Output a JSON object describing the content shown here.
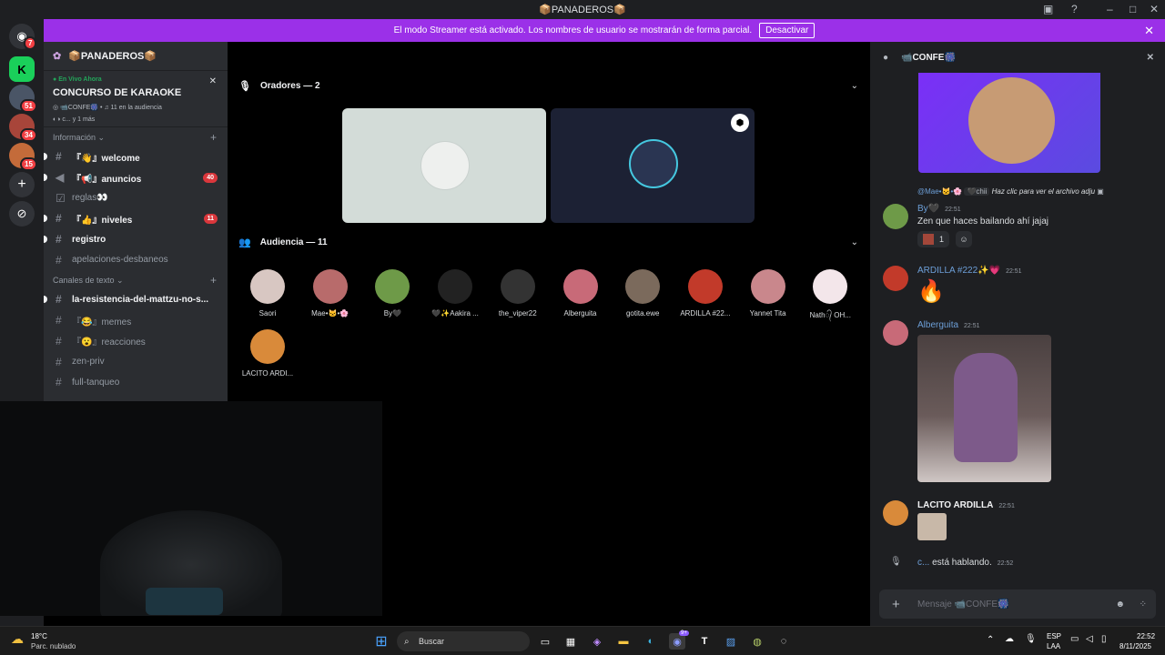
{
  "window": {
    "title": "📦PANADEROS📦"
  },
  "banner": {
    "text": "El modo Streamer está activado. Los nombres de usuario se mostrarán de forma parcial.",
    "button": "Desactivar"
  },
  "guilds": {
    "home_badge": "7",
    "items": [
      {
        "name": "server-k",
        "badge": ""
      },
      {
        "name": "server-2",
        "badge": "51"
      },
      {
        "name": "server-3",
        "badge": "34"
      },
      {
        "name": "server-4",
        "badge": "15"
      }
    ]
  },
  "server": {
    "name": "📦PANADEROS📦"
  },
  "live": {
    "status": "En Vivo Ahora",
    "title": "CONCURSO DE KARAOKE",
    "channel": "📹CONFE🎆",
    "audience": "11 en la audiencia",
    "participants": "c... y 1 más"
  },
  "categories": {
    "info": "Información",
    "text": "Canales de texto"
  },
  "channels_info": [
    {
      "label": "『👋』welcome",
      "unread": true,
      "count": ""
    },
    {
      "label": "『📢』anuncios",
      "unread": true,
      "count": "40"
    },
    {
      "label": "reglas👀",
      "unread": false,
      "count": ""
    },
    {
      "label": "『👍』niveles",
      "unread": true,
      "count": "11"
    },
    {
      "label": "registro",
      "unread": true,
      "count": ""
    },
    {
      "label": "apelaciones-desbaneos",
      "unread": false,
      "count": ""
    }
  ],
  "channels_text": [
    {
      "label": "la-resistencia-del-mattzu-no-s...",
      "unread": true
    },
    {
      "label": "『😂』memes",
      "unread": false
    },
    {
      "label": "『😮』reacciones",
      "unread": false
    },
    {
      "label": "zen-priv",
      "unread": false
    },
    {
      "label": "full-tanqueo",
      "unread": false
    }
  ],
  "stage": {
    "speakers_label": "Oradores — 2",
    "audience_label": "Audiencia — 11",
    "audience": [
      {
        "name": "Saori",
        "color": "#d8c7c2"
      },
      {
        "name": "Mae•🐱•🌸",
        "color": "#b86b6b"
      },
      {
        "name": "By🖤",
        "color": "#6e9a48"
      },
      {
        "name": "🖤✨Aakira ...",
        "color": "#222"
      },
      {
        "name": "the_viper22",
        "color": "#333"
      },
      {
        "name": "Alberguita",
        "color": "#c86a78"
      },
      {
        "name": "gotita.ewe",
        "color": "#7b6a5c"
      },
      {
        "name": "ARDILLA #22...",
        "color": "#c23a2a"
      },
      {
        "name": "Yannet Tita",
        "color": "#c9878c"
      },
      {
        "name": "Nath᭄ OH...",
        "color": "#f3e6ea"
      },
      {
        "name": "LACITO ARDI...",
        "color": "#d98a3a"
      }
    ]
  },
  "chat": {
    "channel": "📹CONFE🎆",
    "reply_to": "@Mae•🐱•🌸",
    "reply_tag": "🖤chii",
    "reply_text": "Haz clic para ver el archivo adju",
    "messages": [
      {
        "author": "By🖤",
        "time": "22:51",
        "text": "Zen que haces bailando ahí jajaj",
        "reaction_count": "1"
      },
      {
        "author": "ARDILLA #222✨💗",
        "time": "22:51",
        "text": "🔥"
      },
      {
        "author": "Alberguita",
        "time": "22:51",
        "text": ""
      },
      {
        "author": "LACITO ARDILLA",
        "time": "22:51",
        "text": ""
      }
    ],
    "speaking_user": "c...",
    "speaking_text": "está hablando.",
    "speaking_time": "22:52",
    "input_placeholder": "Mensaje 📹CONFE🎆"
  },
  "taskbar": {
    "weather_temp": "18°C",
    "weather_desc": "Parc. nublado",
    "search": "Buscar",
    "lang1": "ESP",
    "lang2": "LAA",
    "time": "22:52",
    "date": "8/11/2025",
    "discord_badge": "9+"
  }
}
